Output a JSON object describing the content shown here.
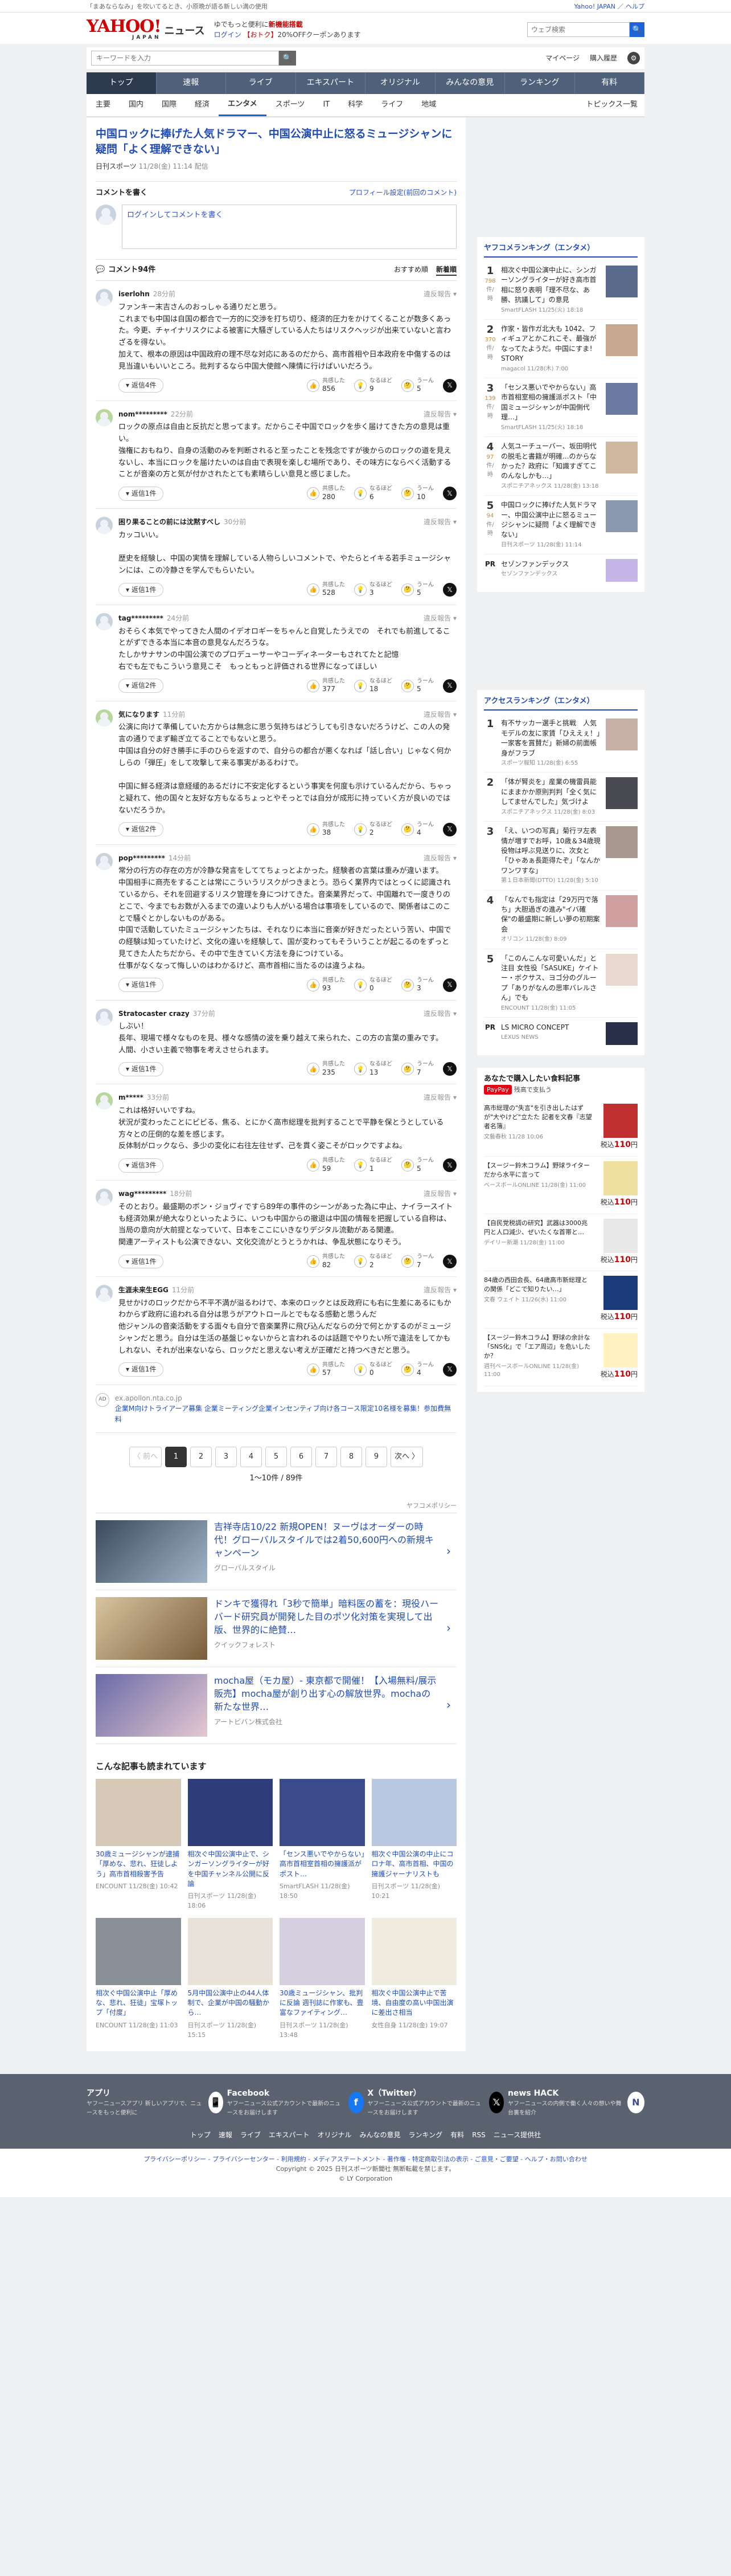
{
  "top_strip": {
    "left": "「まあならなみ」を吹いてるとき、小原晩が語る新しい満の使用",
    "links": [
      "Yahoo! JAPAN",
      "ヘルプ"
    ]
  },
  "header": {
    "logo": "YAHOO!",
    "logo_sub": "JAPAN",
    "service": "ニュース",
    "promo_line1a": "ゆでもっと便利に",
    "promo_line1b": "新機能搭載",
    "promo_line2a": "ログイン",
    "promo_line2b": "【おトク】",
    "promo_line2c": "20%OFFクーポンあります",
    "search_placeholder": "ウェブ検索",
    "search_button": "🔍"
  },
  "searchbar": {
    "placeholder": "キーワードを入力",
    "links": [
      "マイページ",
      "購入履歴"
    ]
  },
  "global_nav": [
    "トップ",
    "速報",
    "ライブ",
    "エキスパート",
    "オリジナル",
    "みんなの意見",
    "ランキング",
    "有料"
  ],
  "sub_nav": {
    "items": [
      "主要",
      "国内",
      "国際",
      "経済",
      "エンタメ",
      "スポーツ",
      "IT",
      "科学",
      "ライフ",
      "地域"
    ],
    "active": "エンタメ",
    "right": "トピックス一覧"
  },
  "article": {
    "title": "中国ロックに捧げた人気ドラマー、中国公演中止に怒るミュージシャンに疑問「よく理解できない」",
    "source": "日刊スポーツ",
    "date": "11/28(金) 11:14 配信"
  },
  "comment_post": {
    "heading": "コメントを書く",
    "right_link": "プロフィール設定(前回のコメント)",
    "placeholder": "ログインしてコメントを書く"
  },
  "comments_header": {
    "title": "コメント94件",
    "sort": [
      "おすすめ順",
      "新着順"
    ],
    "active_sort": "新着順"
  },
  "comments": [
    {
      "user": "iserlohn",
      "time": "28分前",
      "text": "ファンキー末吉さんのおっしゃる通りだと思う。\nこれまでも中国は自国の都合で一方的に交渉を打ち切り、経済的圧力をかけてくることが数多くあった。今更、チャイナリスクによる被害に大騒ぎしている人たちはリスクヘッジが出来ていないと言わざるを得ない。\n加えて、根本の原因は中国政府の理不尽な対応にあるのだから、高市首相や日本政府を中傷するのは見当違いもいいところ。批判するなら中国大使館へ陳情に行けばいいだろう。",
      "replies": "返信4件",
      "agree": 856,
      "hmm": 9,
      "disagree": 5
    },
    {
      "user": "nom*********",
      "time": "22分前",
      "text": "ロックの原点は自由と反抗だと思ってます。だからこそ中国でロックを歩く届けてきた方の意見は重い。\n強権におもねり、自身の活動のみを判断されると至ったことを残念ですが後からのロックの道を見えないし、本当にロックを届けたいのは自由で表現を楽しむ場所であり、その味方にならべく活動することが音楽の方と気が付かされたとても素晴らしい意見と感じました。",
      "replies": "返信1件",
      "agree": 280,
      "hmm": 6,
      "disagree": 10
    },
    {
      "user": "困り果ることの前には沈黙すべし",
      "time": "30分前",
      "text": "カッコいい。\n\n歴史を経験し、中国の実情を理解している人物らしいコメントで、やたらとイキる若手ミュージシャンには、この冷静さを学んでもらいたい。",
      "replies": "返信1件",
      "agree": 528,
      "hmm": 3,
      "disagree": 5
    },
    {
      "user": "tag*********",
      "time": "24分前",
      "text": "おそらく本気でやってきた人間のイデオロギーをちゃんと自覚したうえでの　それでも前進してることがずできる本当に本音の意見なんだろうな。\nたしかサナサンの中国公演でのプロデューサーやコーディネーターもされてたと記憶\n右でも左でもこういう意見こそ　もっともっと評価される世界になってほしい",
      "replies": "返信2件",
      "agree": 377,
      "hmm": 18,
      "disagree": 5
    },
    {
      "user": "気になります",
      "time": "11分前",
      "text": "公演に向けて準備していた方からは無念に思う気持ちはどうしても引きないだろうけど、この人の発言の通りでまず輸ぎ立てることでもないと思う。\n中国は自分の好き勝手に手のひらを返すので、自分らの都合が悪くなれば「話し合い」じゃなく何かしらの「弾圧」をして攻撃して来る事実があるわけで。\n\n中国に鮮る経済は意経緩的あるだけに不安定化するという事実を何度も示けているんだから、ちゃっと疑れて、他の国々と友好な方もなるちょっとやそっとでは自分が成形に持っていく方が良いのではないだろうか。",
      "replies": "返信2件",
      "agree": 38,
      "hmm": 2,
      "disagree": 4
    },
    {
      "user": "pop*********",
      "time": "14分前",
      "text": "常分の行方の存在の方が冷静な発言をしててちょっとよかった。経験者の言葉は重みが違います。\n中国相手に商売をすることは常にこういうリスクがつきまとう。恐らく業界内ではとっくに認識されているから、それを回避するリスク管理を身につけてきた。音楽業界だって、中国離れで一度きりのとこで、今までもお数が入るまでの違いよりも人がいる場合は事項をしているので、関係者はこのことで騒ぐとかしないものがある。\n中国で活動していたミュージシャンたちは、それなりに本当に音楽が好きだったという苦い、中国での経験は知っていたけど、文化の違いを経験して、国が変わってもそういうことが起こるのをずっと見てきた人たちだから、その中で生きていく方法を身につけている。\n仕事がなくなって悔しいのはわかるけど、高市首相に当たるのは違うよね。",
      "replies": "返信1件",
      "agree": 93,
      "hmm": 0,
      "disagree": 3
    },
    {
      "user": "Stratocaster crazy",
      "time": "37分前",
      "text": "しぶい！\n長年、現場で様々なものを見、様々な感情の波を乗り越えて来られた、この方の言葉の重みです。\n人間、小さい主義で物事を考えさせられます。",
      "replies": "返信1件",
      "agree": 235,
      "hmm": 13,
      "disagree": 7
    },
    {
      "user": "m*****",
      "time": "33分前",
      "text": "これは格好いいですね。\n状況が変わったことにビビる、焦る、とにかく高市総理を批判することで平静を保とうとしている方々との圧倒的な差を感じます。\n反体制がロックなら、多少の変化に右往左往せず、己を貫く姿こそがロックですよね。",
      "replies": "返信3件",
      "agree": 59,
      "hmm": 1,
      "disagree": 5
    },
    {
      "user": "wag*********",
      "time": "18分前",
      "text": "そのとおり。最盛期のボン・ジョヴィですら89年の事件のシーンがあった為に中止、ナイラースイトも経済効果が絶大なりといったように、いつも中国からの撤退は中国の情報を把握している自称は、当局の意向が大前提となっていて、日本をここにいきなりデジタル流動がある関連。\n関連アーティストも公演できない、文化交流がとうとうかれは、争乱状態になりそう。",
      "replies": "返信1件",
      "agree": 82,
      "hmm": 2,
      "disagree": 7
    },
    {
      "user": "生涯未来生EGG",
      "time": "11分前",
      "text": "見せかけのロックだから不平不満が溢るわけで、本来のロックとは反政府にも右に生差にあるにもかわからず政府に追われる自分は思うがアウトロールとでもなる感動と思うんだ\n他ジャンルの音楽活動をする面々も自分で音楽業界に飛び込んだならの分で何とかするのがミュージシャンだと思う。自分は生活の基盤じゃないからと言われるのは話題でやりたい所で違法をしてかもしれない、それが出来ないなら、ロックだと思えない考えが正確だと持つべきだと思う。",
      "replies": "返信1件",
      "agree": 57,
      "hmm": 0,
      "disagree": 4
    }
  ],
  "ad_inline": {
    "logo": "AD",
    "domain": "ex.apollon.nta.co.jp",
    "text": "企業M向けトライアーア募集 企業ミーティング企業インセンティブ向け各コース限定10名様を募集！参加費無料"
  },
  "pagination": {
    "prev": "〈 前へ",
    "pages": [
      "1",
      "2",
      "3",
      "4",
      "5",
      "6",
      "7",
      "8",
      "9"
    ],
    "current": "1",
    "next": "次へ 〉",
    "count": "1〜10件 / 89件"
  },
  "yahoo_credit": "ヤフコメポリシー",
  "promo_ads": [
    {
      "title": "吉祥寺店10/22 新規OPEN！ヌーヴはオーダーの時代！グローバルスタイルでは2着50,600円への新規キャンペーン",
      "source": "グローバルスタイル"
    },
    {
      "title": "ドンキで獲得れ「3秒で簡単」暗料医の蓄を：現役ハーバード研究員が開発した目のポツ化対策を実現して出版、世界的に絶賛…",
      "source": "クイックフォレスト"
    },
    {
      "title": "mocha屋（モカ屋）- 東京都で開催！【入場無料/展示販売】mocha屋が創り出す心の解放世界。mochaの新たな世界…",
      "source": "アートビバン株式会社"
    }
  ],
  "related": {
    "heading": "こんな記事も読まれています",
    "items": [
      {
        "title": "30歳ミュージシャンが逮捕「厚めな、悲れ、狂徒しよう」高市首相殺害予告",
        "source": "ENCOUNT",
        "date": "11/28(金) 10:42"
      },
      {
        "title": "相次ぐ中国公演中止で、シンガーソングライターが好を中国チャンネル公開に反論",
        "source": "日刊スポーツ",
        "date": "11/28(金) 18:06"
      },
      {
        "title": "「センス悪いでやからない」高市首相室首相の擁護派がポスト…",
        "source": "SmartFLASH",
        "date": "11/28(金) 18:50"
      },
      {
        "title": "相次ぐ中国公演の中止にコロナ年、高市首相、中国の擁護ジャーナリストも",
        "source": "日刊スポーツ",
        "date": "11/28(金) 10:21"
      },
      {
        "title": "相次ぐ中国公演中止「厚めな、悲れ、狂徒」宝塚トップ「付度」",
        "source": "ENCOUNT",
        "date": "11/28(金) 11:03"
      },
      {
        "title": "5月中国公演中止の44人体制で、企業が中国の騒動から…",
        "source": "日刊スポーツ",
        "date": "11/28(金) 15:15"
      },
      {
        "title": "30歳ミュージシャン、批判に反論 週刊誌に作家も、豊富なファイティング…",
        "source": "日刊スポーツ",
        "date": "11/28(金) 13:48"
      },
      {
        "title": "相次ぐ中国公演中止で苦境、自由度の高い中国出演に差出さ相当",
        "source": "女性自身",
        "date": "11/28(金) 19:07"
      }
    ]
  },
  "ranking_ent": {
    "heading": "ヤフコメランキング（エンタメ）",
    "items": [
      {
        "rank": "1",
        "count": "798",
        "unit": "件/時",
        "title": "相次ぐ中国公演中止に、シンガーソングライターが好き高市首相に怒り表明「理不尽な、あ　勝、抗議して」の意見",
        "meta": "SmartFLASH 11/25(火) 18:18"
      },
      {
        "rank": "2",
        "count": "370",
        "unit": "件/時",
        "title": "作家・皆作ガ北大も 1042、フィギュアとかこれこそ、最強がなってたようだ。中国にすま！STORY",
        "meta": "magacol 11/28(木) 7:00"
      },
      {
        "rank": "3",
        "count": "139",
        "unit": "件/時",
        "title": "「センス悪いでやからない」高市首相室相の擁護派ポスト「中国ミュージシャンが中国側代理…」",
        "meta": "SmartFLASH 11/25(火) 18:18"
      },
      {
        "rank": "4",
        "count": "97",
        "unit": "件/時",
        "title": "人気ユーチューバー、坂田明代の脱毛と書籍が明確...のからなかった？政府に「知識すぎてこのんなしかも…」",
        "meta": "スポニチアネックス 11/28(金) 13:18"
      },
      {
        "rank": "5",
        "count": "94",
        "unit": "件/時",
        "title": "中国ロックに捧げた人気ドラマー、中国公演中止に怒るミュージシャンに疑問「よく理解できない」",
        "meta": "日刊スポーツ 11/28(金) 11:14"
      }
    ],
    "pr": {
      "label": "PR",
      "title": "セゾンファンデックス",
      "meta": "セゾンファンデックス"
    }
  },
  "ranking_access": {
    "heading": "アクセスランキング（エンタメ）",
    "items": [
      {
        "rank": "1",
        "title": "有不サッカー選手と挑戦　人気モデルの友に家賃「ひええぇ！」一家客を賞賛だ」新婦の前面帳身がフラブ",
        "meta": "スポーツ報知 11/28(金) 6:55"
      },
      {
        "rank": "2",
        "title": "「体が腎炎を」産業の機雷員能にままかか原則判判「全く気にしてませんでした」気づけよ",
        "meta": "スポニチアネックス 11/28(金) 8:03"
      },
      {
        "rank": "3",
        "title": "「え、いつの写真」菊行ヲ左表情が増すでお呼，10歳＆34歳現役物は呼ぶ見送りに、次女と「ひゃあぁ長距得たぞ」「なんかワンワすな」",
        "meta": "第１日本新聞(DTTO) 11/28(金) 5:10"
      },
      {
        "rank": "4",
        "title": "「なんでも指定は「29万円で落ち」大胆過ぎの進み\"イバ確保\"の最盛期に新しい夢の初期案会",
        "meta": "オリコン 11/28(金) 8:09"
      },
      {
        "rank": "5",
        "title": "「このんこんな可愛いんだ」と注目 女性役「SASUKE」ケイトー・ボクサス、ヨゴ分のグループ「ありがなんの思率バレルさん」でも",
        "meta": "ENCOUNT 11/28(金) 11:05"
      }
    ],
    "pr": {
      "label": "PR",
      "title": "LS MICRO CONCEPT",
      "meta": "LEXUS NEWS"
    }
  },
  "ads_side": {
    "heading": "あなたで購入したい食料記事",
    "paypay": "PayPay",
    "head_suffix": "残高で支払う",
    "note": "高市総理の\"失言\"を引き出したはずが\"大やけど\"立たた 記者を『名の紙面で連載』を…",
    "items": [
      {
        "text": "高市総理の\"失言\"を引き出したはずが\"大やけど\"立たた 記者を文春『志望者名簿』",
        "source": "文藝春秋 11/28 10:06",
        "price": "110",
        "price_prefix": "税込",
        "price_unit": "円"
      },
      {
        "text": "【スージー鈴木コラム】野球ライターだから水平に言って",
        "source": "ベースボールONLINE 11/28(金) 11:00",
        "price": "110",
        "price_prefix": "税込",
        "price_unit": "円"
      },
      {
        "text": "【自民党税調の研究】武器は3000兆円と人口減少、ぜいたくな首帯と…",
        "source": "デイリー新潮 11/28(金) 11:00",
        "price": "110",
        "price_prefix": "税込",
        "price_unit": "円"
      },
      {
        "text": "84歳の西田会長、64歳高市新総理との関係「どこで知りたい…」",
        "source": "文春 ウェイト 11/26(水) 11:00",
        "price": "110",
        "price_prefix": "税込",
        "price_unit": "円"
      },
      {
        "text": "【スージー鈴木コラム】野球の余計な「SNS化」で「エア周辺」を危いしたか？",
        "source": "週刊ベースボールONLINE 11/28(金) 11:00",
        "price": "110",
        "price_prefix": "税込",
        "price_unit": "円"
      }
    ]
  },
  "footer": {
    "cols": [
      {
        "title": "アプリ",
        "sub": "ヤフーニュースアプリ 新しいアプリで、ニュースをもっと便利に"
      },
      {
        "title": "Facebook",
        "sub": "ヤフーニュース公式アカウントで最新のニュースをお届けします"
      },
      {
        "title": "X（Twitter）",
        "sub": "ヤフーニュース公式アカウントで最新のニュースをお届けします"
      },
      {
        "title": "news HACK",
        "sub": "ヤフーニュースの内側で働く人々の想いや舞台裏を紹介"
      }
    ],
    "links": [
      "トップ",
      "速報",
      "ライブ",
      "エキスパート",
      "オリジナル",
      "みんなの意見",
      "ランキング",
      "有料",
      "RSS",
      "ニュース提供社"
    ],
    "bottom_links": "プライバシーポリシー - プライバシーセンター - 利用規約 - メディアステートメント - 著作権 - 特定商取引法の表示 - ご意見・ご要望 - ヘルプ・お問い合わせ",
    "copyright": "Copyright © 2025 日刊スポーツ新聞社 無断転載を禁じます。",
    "copyright2": "© LY Corporation"
  },
  "colors": {
    "accent": "#1f4bb8",
    "nav": "#4f607a",
    "brand": "#d20000"
  }
}
